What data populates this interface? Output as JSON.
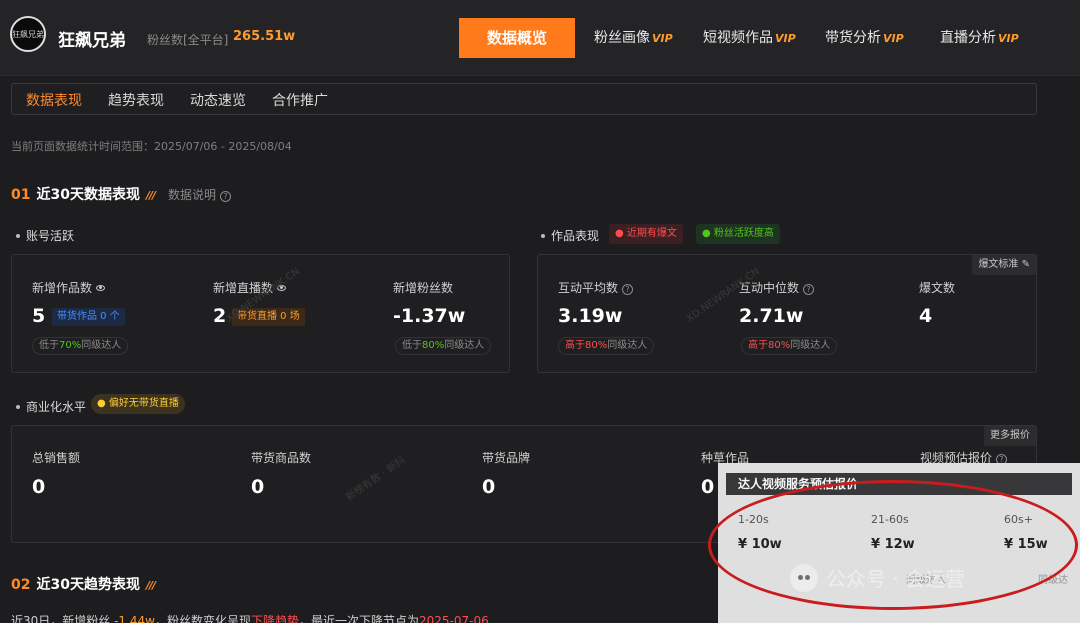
{
  "account": {
    "avatar_text": "狂飙兄弟",
    "name": "狂飙兄弟",
    "fans_label": "粉丝数[全平台]",
    "fans_value": "265.51w"
  },
  "nav": [
    {
      "label": "数据概览",
      "vip": ""
    },
    {
      "label": "粉丝画像",
      "vip": "VIP"
    },
    {
      "label": "短视频作品",
      "vip": "VIP"
    },
    {
      "label": "带货分析",
      "vip": "VIP"
    },
    {
      "label": "直播分析",
      "vip": "VIP"
    }
  ],
  "subtabs": [
    "数据表现",
    "趋势表现",
    "动态速览",
    "合作推广"
  ],
  "date_range": "当前页面数据统计时间范围：2025/07/06 - 2025/08/04",
  "section1": {
    "num": "01",
    "title": "近30天数据表现",
    "note": "数据说明"
  },
  "account_active": {
    "heading": "账号活跃",
    "metrics": [
      {
        "label": "新增作品数",
        "value": "5",
        "tag": "带货作品 0 个",
        "cmp_pre": "低于",
        "cmp_pct": "70%",
        "cmp_post": "同级达人"
      },
      {
        "label": "新增直播数",
        "value": "2",
        "tag": "带货直播 0 场",
        "cmp_pre": "",
        "cmp_pct": "",
        "cmp_post": ""
      },
      {
        "label": "新增粉丝数",
        "value": "-1.37w",
        "tag": "",
        "cmp_pre": "低于",
        "cmp_pct": "80%",
        "cmp_post": "同级达人"
      }
    ]
  },
  "works": {
    "heading": "作品表现",
    "chip_red": "近期有爆文",
    "chip_green": "粉丝活跃度高",
    "corner": "爆文标准",
    "metrics": [
      {
        "label": "互动平均数",
        "value": "3.19w",
        "cmp_pre": "高于",
        "cmp_pct": "80%",
        "cmp_post": "同级达人"
      },
      {
        "label": "互动中位数",
        "value": "2.71w",
        "cmp_pre": "高于",
        "cmp_pct": "80%",
        "cmp_post": "同级达人"
      },
      {
        "label": "爆文数",
        "value": "4"
      }
    ]
  },
  "commerce": {
    "heading": "商业化水平",
    "chip": "偏好无带货直播",
    "corner": "更多报价",
    "metrics": [
      {
        "label": "总销售额",
        "value": "0"
      },
      {
        "label": "带货商品数",
        "value": "0"
      },
      {
        "label": "带货品牌",
        "value": "0"
      },
      {
        "label": "种草作品",
        "value": "0"
      },
      {
        "label": "视频预估报价",
        "value": ""
      }
    ]
  },
  "popup": {
    "title": "达人视频服务预估报价",
    "cols": [
      {
        "range": "1-20s",
        "price": "¥ 10w"
      },
      {
        "range": "21-60s",
        "price": "¥ 12w"
      },
      {
        "range": "60s+",
        "price": "¥ 15w"
      }
    ],
    "fade_a": "同级达人",
    "fade_b": "同级达"
  },
  "section2": {
    "num": "02",
    "title": "近30天趋势表现"
  },
  "trend": {
    "p1": "近30日，新增粉丝 ",
    "v1": "-1.44w",
    "p2": "，粉丝数变化呈现",
    "v2": "下降趋势",
    "p3": "，最近一次下降节点为",
    "v3": "2025-07-06"
  },
  "watermark": "公众号 · 会运营",
  "faint_marks": [
    "XD.NEWRANK.CN",
    "XD.NEWRANK.CN",
    "新榜有数 · 新抖"
  ],
  "colors": {
    "accent": "#ff7a1a",
    "positive": "#52c41a",
    "negative": "#ff4d4f",
    "annotation": "#c91c1c"
  }
}
